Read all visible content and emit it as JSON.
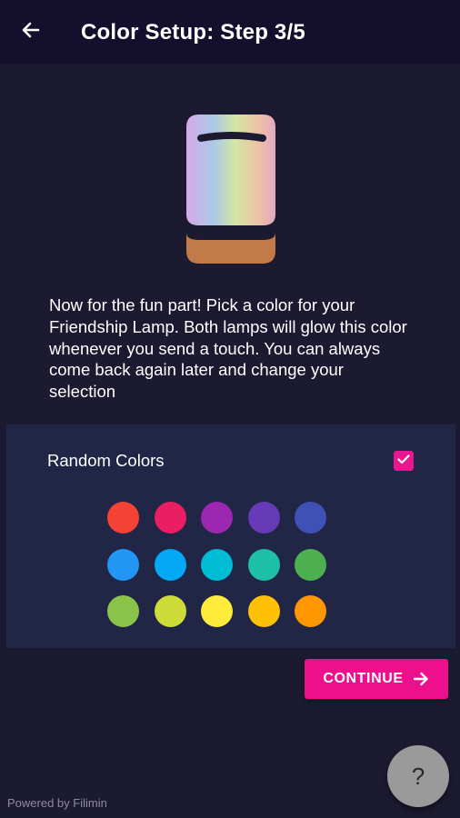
{
  "header": {
    "title": "Color Setup: Step 3/5",
    "back_icon": "arrow-left-icon"
  },
  "lamp": {
    "icon": "friendship-lamp-illustration",
    "gradient_colors": [
      "#d9a8e8",
      "#a7cbe6",
      "#d6e6a6",
      "#eac3a5",
      "#e6a8c0"
    ],
    "base_color": "#c27a48"
  },
  "description": "Now for the fun part! Pick a color for your Friendship Lamp. Both lamps will glow this color whenever you send a touch. You can always come back again later and change your selection",
  "random_colors": {
    "label": "Random Colors",
    "checked": true,
    "check_icon": "checkmark-icon"
  },
  "swatches": [
    "#f44336",
    "#e91e63",
    "#9c27b0",
    "#673ab7",
    "#3f51b5",
    "#2196f3",
    "#03a9f4",
    "#00bcd4",
    "#1fbfa8",
    "#4caf50",
    "#8bc34a",
    "#cddc39",
    "#ffeb3b",
    "#ffc107",
    "#ff9800"
  ],
  "continue_button": {
    "label": "CONTINUE",
    "icon": "arrow-right-icon",
    "color": "#ee0f8d"
  },
  "help_button": {
    "label": "?"
  },
  "footer": {
    "powered_by": "Powered by Filimin"
  }
}
